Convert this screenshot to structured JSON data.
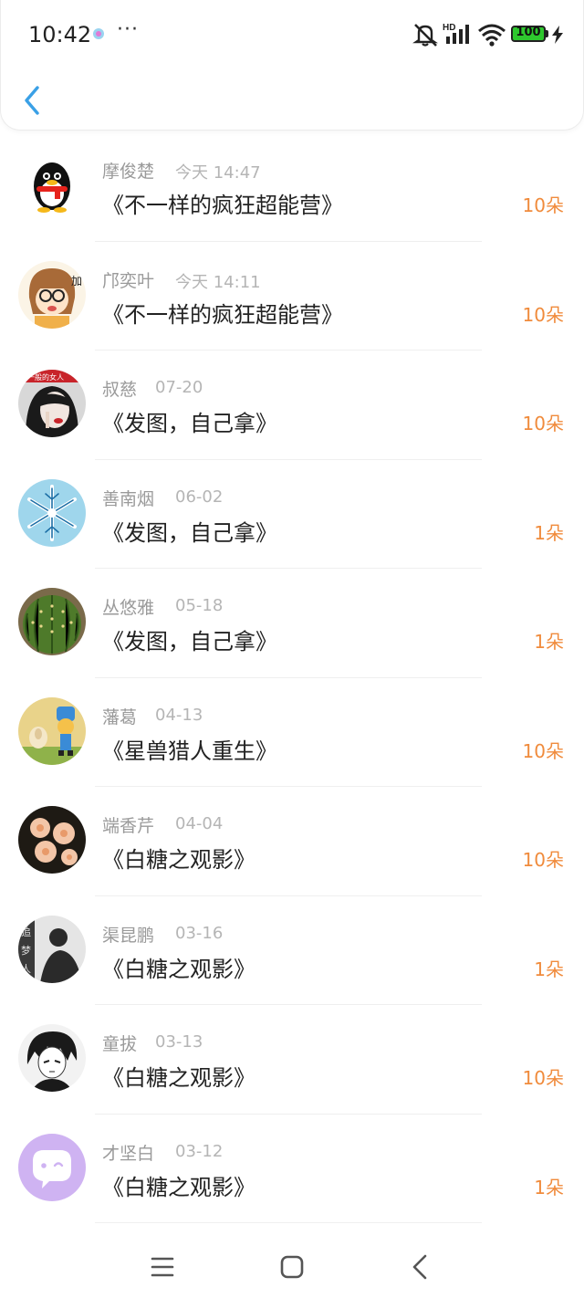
{
  "status_bar": {
    "time": "10:42",
    "more": "···",
    "network": "HD",
    "battery": "100"
  },
  "records": [
    {
      "name": "摩俊楚",
      "date": "今天 14:47",
      "title": "《不一样的疯狂超能营》",
      "amount": "10朵",
      "avatar": "penguin-avatar"
    },
    {
      "name": "邝奕叶",
      "date": "今天 14:11",
      "title": "《不一样的疯狂超能营》",
      "amount": "10朵",
      "avatar": "cartoon-girl-avatar"
    },
    {
      "name": "叔慈",
      "date": "07-20",
      "title": "《发图，自己拿》",
      "amount": "10朵",
      "avatar": "woman-photo-avatar"
    },
    {
      "name": "善南烟",
      "date": "06-02",
      "title": "《发图，自己拿》",
      "amount": "1朵",
      "avatar": "snowflake-avatar"
    },
    {
      "name": "丛悠雅",
      "date": "05-18",
      "title": "《发图，自己拿》",
      "amount": "1朵",
      "avatar": "cactus-avatar"
    },
    {
      "name": "藩葛",
      "date": "04-13",
      "title": "《星兽猎人重生》",
      "amount": "10朵",
      "avatar": "toy-figure-avatar"
    },
    {
      "name": "端香芹",
      "date": "04-04",
      "title": "《白糖之观影》",
      "amount": "10朵",
      "avatar": "flowers-avatar"
    },
    {
      "name": "渠昆鹏",
      "date": "03-16",
      "title": "《白糖之观影》",
      "amount": "1朵",
      "avatar": "bw-person-avatar"
    },
    {
      "name": "童拔",
      "date": "03-13",
      "title": "《白糖之观影》",
      "amount": "10朵",
      "avatar": "anime-sketch-avatar"
    },
    {
      "name": "才坚白",
      "date": "03-12",
      "title": "《白糖之观影》",
      "amount": "1朵",
      "avatar": "chat-bubble-avatar"
    }
  ],
  "avatar_text": {
    "woman_banner": "一般的女人",
    "dream_chars": [
      "追",
      "梦",
      "人"
    ]
  },
  "colors": {
    "accent_back": "#3aa0e6",
    "amount": "#f08b3c",
    "battery": "#2ec82e"
  }
}
